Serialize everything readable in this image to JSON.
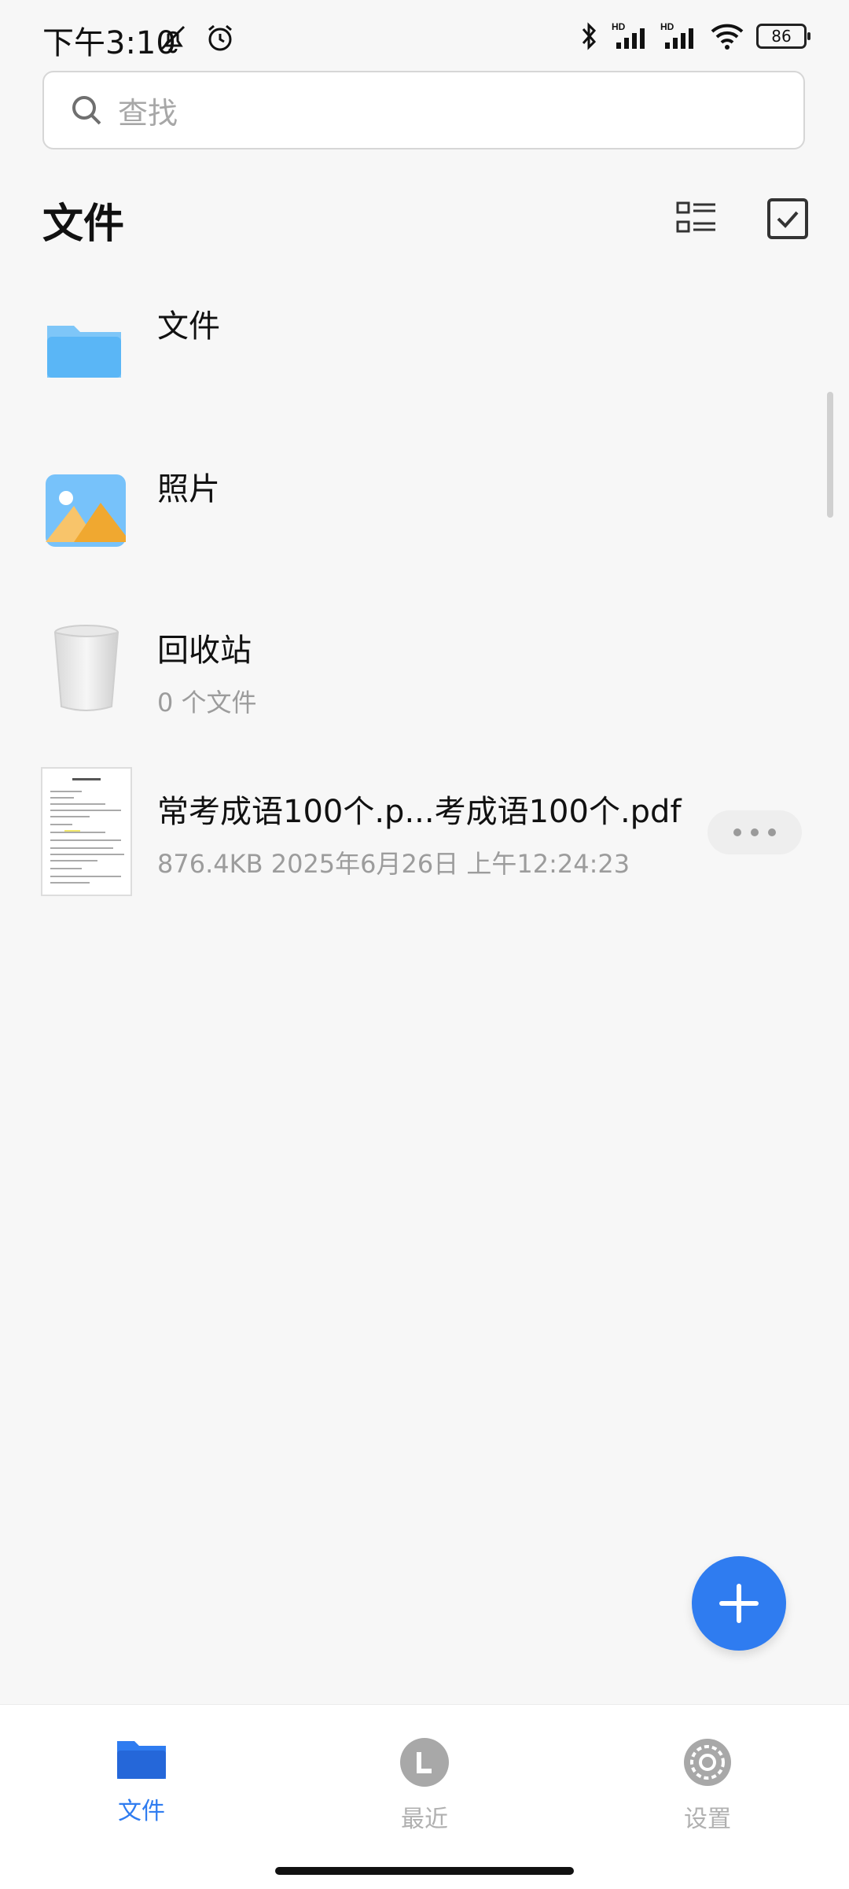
{
  "status_bar": {
    "time": "下午3:10",
    "battery": "86",
    "icons": [
      "mute-icon",
      "alarm-icon",
      "bluetooth-icon",
      "signal-hd-icon",
      "signal-hd-icon",
      "wifi-icon",
      "battery-icon"
    ]
  },
  "search": {
    "placeholder": "查找"
  },
  "header": {
    "title": "文件"
  },
  "items": [
    {
      "name": "文件",
      "subtitle": "",
      "icon": "folder-icon"
    },
    {
      "name": "照片",
      "subtitle": "",
      "icon": "photo-icon"
    },
    {
      "name": "回收站",
      "subtitle": "0 个文件",
      "icon": "trash-icon"
    },
    {
      "name": "常考成语100个.p...考成语100个.pdf",
      "subtitle": "876.4KB 2025年6月26日 上午12:24:23",
      "icon": "pdf-thumbnail"
    }
  ],
  "bottom_nav": {
    "items": [
      {
        "label": "文件",
        "icon": "folder-icon",
        "active": true
      },
      {
        "label": "最近",
        "icon": "recent-icon",
        "active": false
      },
      {
        "label": "设置",
        "icon": "settings-icon",
        "active": false
      }
    ]
  },
  "colors": {
    "accent": "#2f7cf0",
    "muted": "#9c9c9c"
  }
}
